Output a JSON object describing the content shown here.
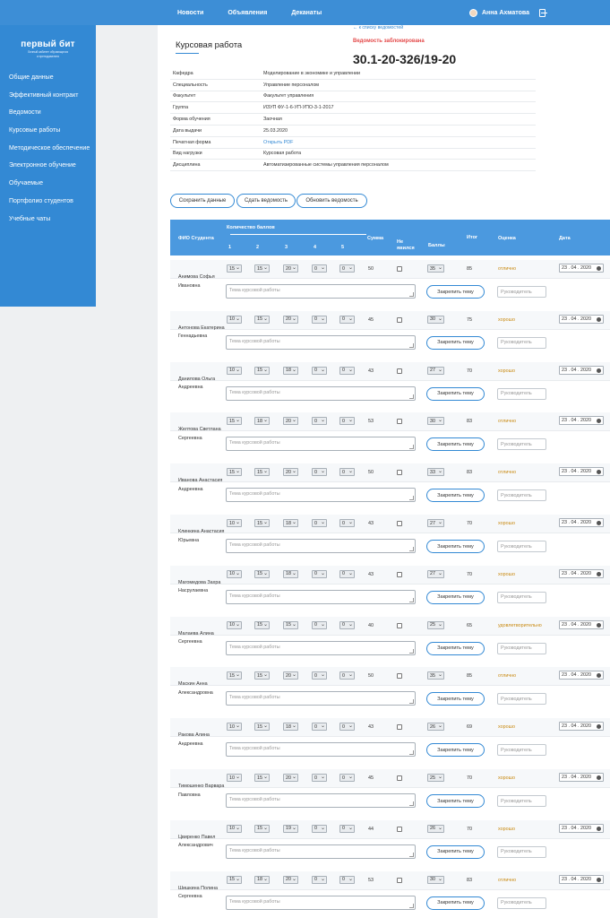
{
  "topnav": [
    "Новости",
    "Объявления",
    "Деканаты"
  ],
  "user": {
    "name": "Анна Ахматова"
  },
  "logo": {
    "brand": "первый бит",
    "sub1": "Личный кабинет обучающихся",
    "sub2": "и преподавателя"
  },
  "sidebar": [
    "Общие данные",
    "Эффективный контракт",
    "Ведомости",
    "Курсовые работы",
    "Методическое обеспечение",
    "Электронное обучение",
    "Обучаемые",
    "Портфолио студентов",
    "Учебные чаты"
  ],
  "page": {
    "title": "Курсовая работа",
    "back": "← к списку ведомостей",
    "status": "Ведомость заблокирована",
    "number": "30.1-20-326/19-20"
  },
  "info": [
    {
      "k": "Кафедра",
      "v": "Моделирование в экономике и управлении"
    },
    {
      "k": "Специальность",
      "v": "Управление персоналом"
    },
    {
      "k": "Факультет",
      "v": "Факультет управления"
    },
    {
      "k": "Группа",
      "v": "ИЗУП ФУ-1-6-УП-УПО-3-1-2017"
    },
    {
      "k": "Форма обучения",
      "v": "Заочная"
    },
    {
      "k": "Дата выдачи",
      "v": "25.03.2020"
    },
    {
      "k": "Печатная форма",
      "v": "Открыть PDF",
      "link": true
    },
    {
      "k": "Вид нагрузки",
      "v": "Курсовая работа"
    },
    {
      "k": "Дисциплина",
      "v": "Автоматизированные системы управления персоналом"
    }
  ],
  "buttons": {
    "save": "Сохранить данные",
    "submit": "Сдать ведомость",
    "refresh": "Обновить ведомость"
  },
  "table": {
    "fio": "ФИО Студента",
    "points": "Количество баллов",
    "cols": [
      "1",
      "2",
      "3",
      "4",
      "5"
    ],
    "sum": "Сумма",
    "absent1": "Не",
    "absent2": "явился",
    "balls": "Баллы",
    "total": "Итог",
    "grade": "Оценка",
    "date": "Дата",
    "topic_placeholder": "Тема курсовой работы",
    "fix_btn": "Закрепить тему",
    "supervisor_placeholder": "Руководитель"
  },
  "students": [
    {
      "name": "Анимова Софья Ивановна",
      "s": [
        "15",
        "15",
        "20",
        "0",
        "0"
      ],
      "sum": "50",
      "b": "35",
      "total": "85",
      "grade": "отлично",
      "date": "23 . 04 . 2020"
    },
    {
      "name": "Антонова Екатерина Геннадьевна",
      "s": [
        "10",
        "15",
        "20",
        "0",
        "0"
      ],
      "sum": "45",
      "b": "30",
      "total": "75",
      "grade": "хорошо",
      "date": "23 . 04 . 2020"
    },
    {
      "name": "Данилова Ольга Андреевна",
      "s": [
        "10",
        "15",
        "18",
        "0",
        "0"
      ],
      "sum": "43",
      "b": "27",
      "total": "70",
      "grade": "хорошо",
      "date": "23 . 04 . 2020"
    },
    {
      "name": "Желтова Светлана Сергеевна",
      "s": [
        "15",
        "18",
        "20",
        "0",
        "0"
      ],
      "sum": "53",
      "b": "30",
      "total": "83",
      "grade": "отлично",
      "date": "23 . 04 . 2020"
    },
    {
      "name": "Иванова Анастасия Андреевна",
      "s": [
        "15",
        "15",
        "20",
        "0",
        "0"
      ],
      "sum": "50",
      "b": "33",
      "total": "83",
      "grade": "отлично",
      "date": "23 . 04 . 2020"
    },
    {
      "name": "Клинкина Анастасия Юрьевна",
      "s": [
        "10",
        "15",
        "18",
        "0",
        "0"
      ],
      "sum": "43",
      "b": "27",
      "total": "70",
      "grade": "хорошо",
      "date": "23 . 04 . 2020"
    },
    {
      "name": "Магомедова Захра Насрулаевна",
      "s": [
        "10",
        "15",
        "18",
        "0",
        "0"
      ],
      "sum": "43",
      "b": "27",
      "total": "70",
      "grade": "хорошо",
      "date": "23 . 04 . 2020"
    },
    {
      "name": "Малаева Алина Сергеевна",
      "s": [
        "10",
        "15",
        "15",
        "0",
        "0"
      ],
      "sum": "40",
      "b": "25",
      "total": "65",
      "grade": "удовлетворительно",
      "date": "23 . 04 . 2020"
    },
    {
      "name": "Маскин Анна Александровна",
      "s": [
        "15",
        "15",
        "20",
        "0",
        "0"
      ],
      "sum": "50",
      "b": "35",
      "total": "85",
      "grade": "отлично",
      "date": "23 . 04 . 2020"
    },
    {
      "name": "Ракова Алина Андреевна",
      "s": [
        "10",
        "15",
        "18",
        "0",
        "0"
      ],
      "sum": "43",
      "b": "26",
      "total": "69",
      "grade": "хорошо",
      "date": "23 . 04 . 2020"
    },
    {
      "name": "Тимошенко Варвара Павловна",
      "s": [
        "10",
        "15",
        "20",
        "0",
        "0"
      ],
      "sum": "45",
      "b": "25",
      "total": "70",
      "grade": "хорошо",
      "date": "23 . 04 . 2020"
    },
    {
      "name": "Цвиренко Павел Александрович",
      "s": [
        "10",
        "15",
        "19",
        "0",
        "0"
      ],
      "sum": "44",
      "b": "26",
      "total": "70",
      "grade": "хорошо",
      "date": "23 . 04 . 2020"
    },
    {
      "name": "Шишкина Полина Сергеевна",
      "s": [
        "15",
        "18",
        "20",
        "0",
        "0"
      ],
      "sum": "53",
      "b": "30",
      "total": "83",
      "grade": "отлично",
      "date": "23 . 04 . 2020"
    }
  ]
}
